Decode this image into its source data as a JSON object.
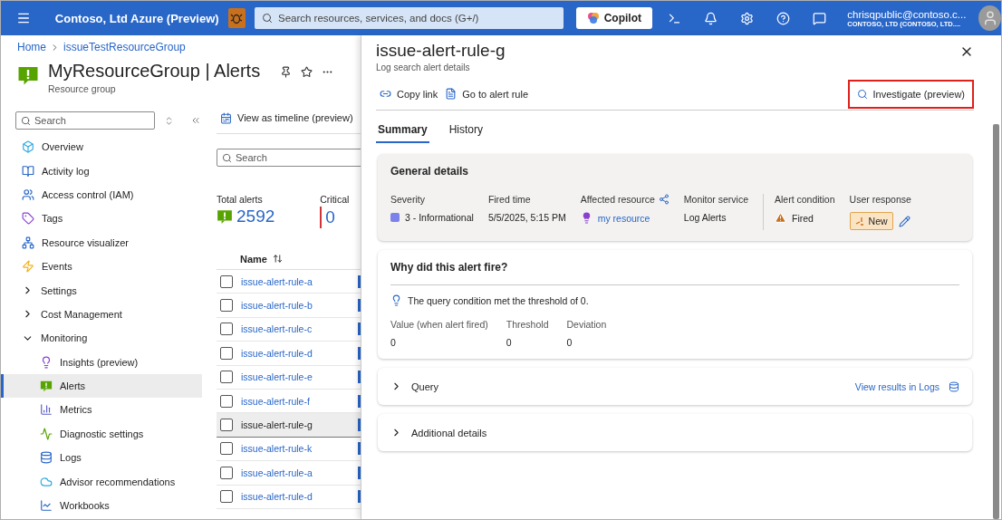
{
  "top_bar": {
    "title": "Contoso, Ltd Azure (Preview)",
    "search_placeholder": "Search resources, services, and docs (G+/)",
    "copilot": "Copilot",
    "account": "chrisqpublic@contoso.c...",
    "tenant": "CONTOSO, LTD (CONTOSO, LTD...."
  },
  "breadcrumb": [
    "Home",
    "issueTestResourceGroup"
  ],
  "resource": {
    "title": "MyResourceGroup | Alerts",
    "subtitle": "Resource group"
  },
  "nav": {
    "search_placeholder": "Search",
    "items": [
      {
        "kind": "item",
        "label": "Overview",
        "selected": false
      },
      {
        "kind": "item",
        "label": "Activity log",
        "selected": false
      },
      {
        "kind": "item",
        "label": "Access control (IAM)",
        "selected": false
      },
      {
        "kind": "item",
        "label": "Tags",
        "selected": false
      },
      {
        "kind": "item",
        "label": "Resource visualizer",
        "selected": false
      },
      {
        "kind": "item",
        "label": "Events",
        "selected": false
      },
      {
        "kind": "group",
        "label": "Settings",
        "expanded": false
      },
      {
        "kind": "group",
        "label": "Cost Management",
        "expanded": false
      },
      {
        "kind": "group",
        "label": "Monitoring",
        "expanded": true,
        "children": [
          {
            "kind": "item",
            "label": "Insights (preview)",
            "selected": false
          },
          {
            "kind": "item",
            "label": "Alerts",
            "selected": true
          },
          {
            "kind": "item",
            "label": "Metrics",
            "selected": false
          },
          {
            "kind": "item",
            "label": "Diagnostic settings",
            "selected": false
          },
          {
            "kind": "item",
            "label": "Logs",
            "selected": false
          },
          {
            "kind": "item",
            "label": "Advisor recommendations",
            "selected": false
          },
          {
            "kind": "item",
            "label": "Workbooks",
            "selected": false
          }
        ]
      }
    ]
  },
  "alerts": {
    "toolbar_button": "View as timeline (preview)",
    "search_placeholder": "Search",
    "summary": [
      {
        "label": "Total alerts",
        "value": "2592",
        "kind": "total"
      },
      {
        "label": "Critical",
        "value": "0",
        "kind": "critical"
      }
    ],
    "column": "Name",
    "rows": [
      {
        "name": "issue-alert-rule-a",
        "selected": false
      },
      {
        "name": "issue-alert-rule-b",
        "selected": false
      },
      {
        "name": "issue-alert-rule-c",
        "selected": false
      },
      {
        "name": "issue-alert-rule-d",
        "selected": false
      },
      {
        "name": "issue-alert-rule-e",
        "selected": false
      },
      {
        "name": "issue-alert-rule-f",
        "selected": false
      },
      {
        "name": "issue-alert-rule-g",
        "selected": true
      },
      {
        "name": "issue-alert-rule-k",
        "selected": false
      },
      {
        "name": "issue-alert-rule-a",
        "selected": false
      },
      {
        "name": "issue-alert-rule-d",
        "selected": false
      }
    ]
  },
  "detail": {
    "title": "issue-alert-rule-g",
    "subtitle": "Log search alert details",
    "actions": [
      {
        "label": "Copy link",
        "kind": "link"
      },
      {
        "label": "Go to alert rule",
        "kind": "rule"
      }
    ],
    "investigate": "Investigate (preview)",
    "tabs": [
      {
        "label": "Summary",
        "selected": true
      },
      {
        "label": "History",
        "selected": false
      }
    ],
    "general": {
      "title": "General details",
      "fields": [
        {
          "label": "Severity",
          "value": "3 - Informational",
          "kind": "severity",
          "color": "#7b83eb"
        },
        {
          "label": "Fired time",
          "value": "5/5/2025, 5:15 PM",
          "kind": "text"
        },
        {
          "label": "Affected resource",
          "value": "my resource",
          "kind": "resource"
        },
        {
          "label": "Monitor service",
          "value": "Log Alerts",
          "kind": "text"
        },
        {
          "label": "Alert condition",
          "value": "Fired",
          "kind": "condition"
        },
        {
          "label": "User response",
          "value": "New",
          "kind": "response"
        }
      ]
    },
    "why": {
      "title": "Why did this alert fire?",
      "message": "The query condition met the threshold of 0.",
      "metrics": [
        {
          "label": "Value (when alert fired)",
          "value": "0"
        },
        {
          "label": "Threshold",
          "value": "0"
        },
        {
          "label": "Deviation",
          "value": "0"
        }
      ]
    },
    "sections": [
      {
        "label": "Query",
        "expanded": false,
        "link": "View results in Logs"
      },
      {
        "label": "Additional details",
        "expanded": false
      }
    ]
  }
}
